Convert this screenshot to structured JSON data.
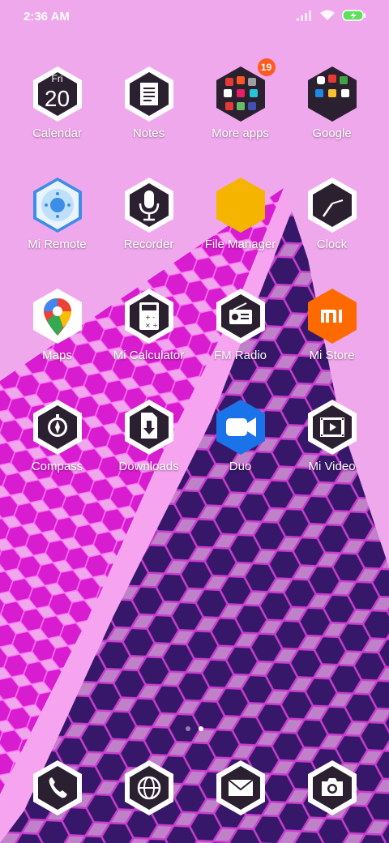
{
  "status_bar": {
    "time": "2:36 AM",
    "icons": [
      "signal-icon",
      "wifi-icon",
      "battery-charging-icon"
    ]
  },
  "apps": [
    {
      "label": "Calendar",
      "icon": "calendar-icon",
      "day": "Fri",
      "date": "20"
    },
    {
      "label": "Notes",
      "icon": "notes-icon"
    },
    {
      "label": "More apps",
      "icon": "folder-icon",
      "badge": "19"
    },
    {
      "label": "Google",
      "icon": "google-folder-icon"
    },
    {
      "label": "Mi Remote",
      "icon": "remote-icon"
    },
    {
      "label": "Recorder",
      "icon": "microphone-icon"
    },
    {
      "label": "File Manager",
      "icon": "file-manager-icon"
    },
    {
      "label": "Clock",
      "icon": "clock-icon"
    },
    {
      "label": "Maps",
      "icon": "maps-pin-icon"
    },
    {
      "label": "Mi Calculator",
      "icon": "calculator-icon"
    },
    {
      "label": "FM Radio",
      "icon": "radio-icon"
    },
    {
      "label": "Mi Store",
      "icon": "mi-logo-icon"
    },
    {
      "label": "Compass",
      "icon": "compass-icon"
    },
    {
      "label": "Downloads",
      "icon": "download-icon"
    },
    {
      "label": "Duo",
      "icon": "video-call-icon"
    },
    {
      "label": "Mi Video",
      "icon": "film-icon"
    }
  ],
  "dock": [
    {
      "icon": "phone-icon"
    },
    {
      "icon": "browser-globe-icon"
    },
    {
      "icon": "messages-envelope-icon"
    },
    {
      "icon": "camera-icon"
    }
  ],
  "pager": {
    "pages": 2,
    "active": 2
  },
  "colors": {
    "hex_border": "#ffffff",
    "hex_fill": "#2b2030",
    "mi_orange": "#ff6a00",
    "duo_blue": "#1a73e8",
    "file_yellow": "#f4b400",
    "remote_blue": "#3b8de8"
  }
}
